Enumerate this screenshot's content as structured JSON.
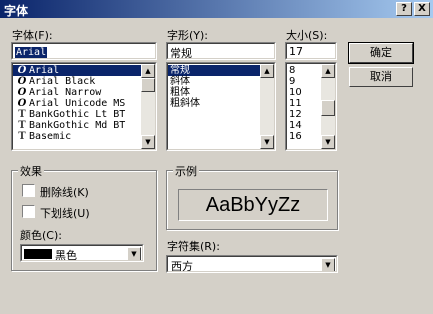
{
  "window": {
    "title": "字体",
    "help_btn": "?",
    "close_btn": "X"
  },
  "font_name": {
    "label": "字体(F):",
    "value": "Arial",
    "items": [
      {
        "icon": "O",
        "name": "Arial",
        "type": "o"
      },
      {
        "icon": "O",
        "name": "Arial Black",
        "type": "o"
      },
      {
        "icon": "O",
        "name": "Arial Narrow",
        "type": "o"
      },
      {
        "icon": "O",
        "name": "Arial Unicode MS",
        "type": "o"
      },
      {
        "icon": "T",
        "name": "BankGothic Lt BT",
        "type": "t"
      },
      {
        "icon": "T",
        "name": "BankGothic Md BT",
        "type": "t"
      },
      {
        "icon": "T",
        "name": "Basemic",
        "type": "t"
      }
    ]
  },
  "font_style": {
    "label": "字形(Y):",
    "value": "常规",
    "items": [
      "常规",
      "斜体",
      "粗体",
      "粗斜体"
    ]
  },
  "font_size": {
    "label": "大小(S):",
    "value": "17",
    "items": [
      "8",
      "9",
      "10",
      "11",
      "12",
      "14",
      "16"
    ]
  },
  "buttons": {
    "ok": "确定",
    "cancel": "取消"
  },
  "effects": {
    "title": "效果",
    "strikeout": "删除线(K)",
    "underline": "下划线(U)",
    "color_label": "颜色(C):",
    "color_value": "黑色",
    "color_swatch": "#000000"
  },
  "sample": {
    "title": "示例",
    "text": "AaBbYyZz"
  },
  "charset": {
    "label": "字符集(R):",
    "value": "西方"
  },
  "icons": {
    "scroll_up": "up-arrow-icon",
    "scroll_down": "down-arrow-icon",
    "dropdown": "chevron-down-icon"
  }
}
